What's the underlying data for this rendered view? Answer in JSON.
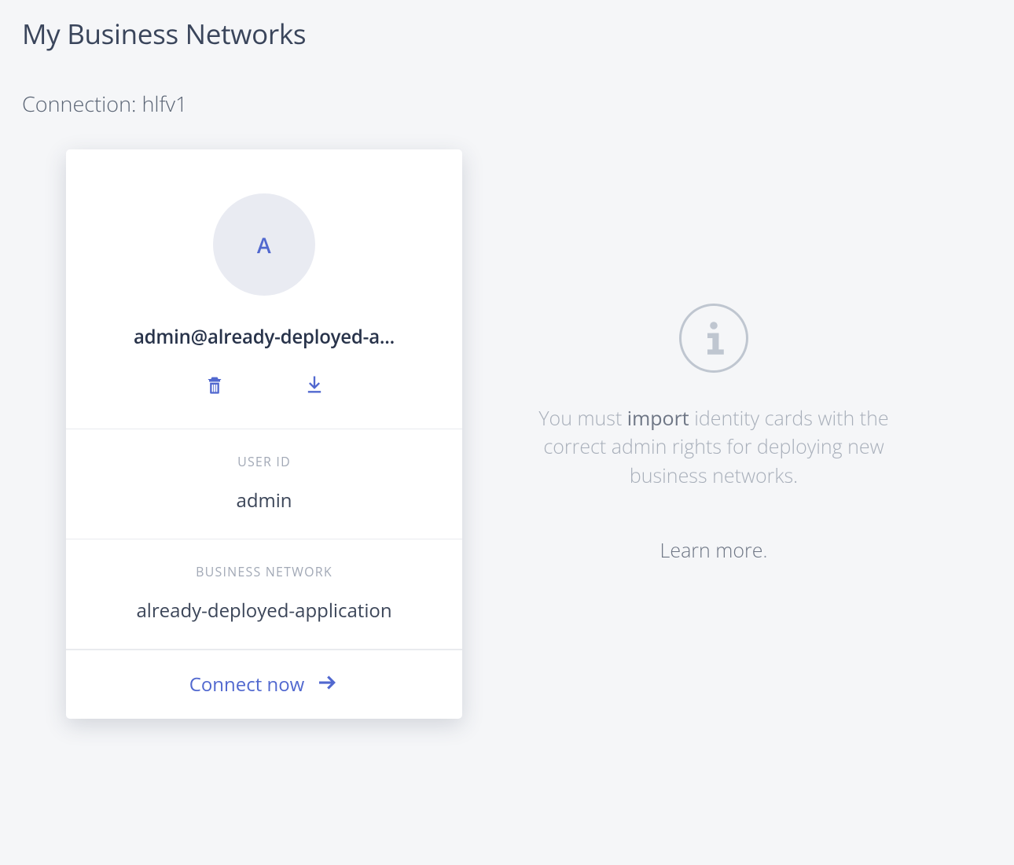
{
  "page": {
    "title": "My Business Networks",
    "connection_label": "Connection: hlfv1"
  },
  "card": {
    "avatar_initial": "A",
    "identity": "admin@already-deployed-a...",
    "user_id_label": "USER ID",
    "user_id_value": "admin",
    "network_label": "BUSINESS NETWORK",
    "network_value": "already-deployed-application",
    "connect_label": "Connect now"
  },
  "info": {
    "text_prefix": "You must ",
    "text_strong": "import",
    "text_suffix": " identity cards with the correct admin rights for deploying new business networks.",
    "learn_more": "Learn more",
    "learn_more_suffix": "."
  },
  "icons": {
    "trash": "trash-icon",
    "download": "download-icon",
    "arrow": "arrow-right-icon",
    "info": "info-icon"
  }
}
